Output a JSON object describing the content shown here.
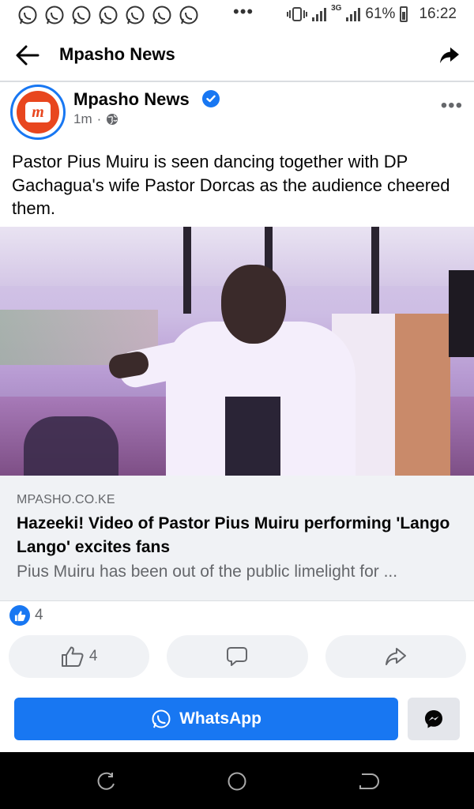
{
  "status_bar": {
    "battery": "61%",
    "time": "16:22",
    "network": "3G",
    "notification_icons": [
      "whatsapp-icon",
      "whatsapp-icon",
      "whatsapp-icon",
      "whatsapp-icon",
      "whatsapp-icon",
      "whatsapp-icon",
      "whatsapp-icon"
    ],
    "overflow": "•••"
  },
  "app_bar": {
    "title": "Mpasho News"
  },
  "post": {
    "page_name": "Mpasho News",
    "avatar_letter": "m",
    "time": "1m",
    "dot": "·",
    "more": "•••",
    "text": "Pastor Pius Muiru is seen dancing together with DP Gachagua's wife Pastor Dorcas as the audience cheered them."
  },
  "link_preview": {
    "domain": "MPASHO.CO.KE",
    "title": "Hazeeki! Video of Pastor Pius Muiru performing 'Lango Lango' excites fans",
    "description": "Pius Muiru has been out of the public limelight for ..."
  },
  "reactions": {
    "count": "4"
  },
  "actions": {
    "like_count": "4"
  },
  "whatsapp_button": {
    "label": "WhatsApp"
  },
  "colors": {
    "accent": "#1877f2",
    "brand_avatar": "#e8461e",
    "muted_text": "#65676b"
  }
}
